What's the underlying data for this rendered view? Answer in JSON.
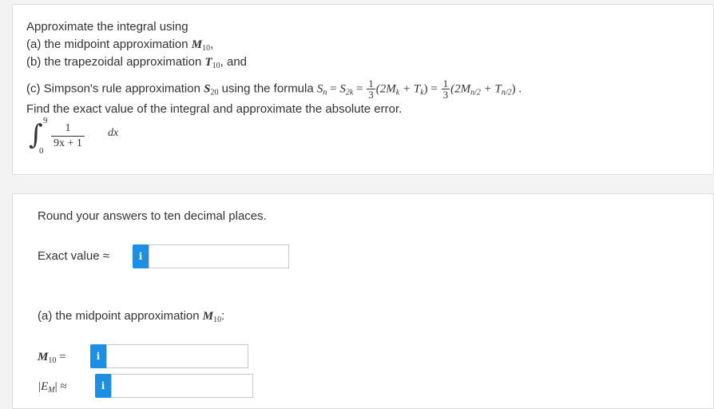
{
  "question": {
    "line1": "Approximate the integral using",
    "line2_text": "(a) the midpoint approximation ",
    "line2_math": "M",
    "line2_sub": "10",
    "line2_end": ",",
    "line3_text": "(b) the trapezoidal approximation ",
    "line3_math": "T",
    "line3_sub": "10",
    "line3_end": ",  and",
    "line4_text": "(c) Simpson's rule approximation ",
    "line4_S": "S",
    "line4_S_sub": "20",
    "line4_using": " using the formula ",
    "line4_Sn": "S",
    "line4_n": "n",
    "line4_eq1": " = ",
    "line4_S2k": "S",
    "line4_2k": "2k",
    "line4_eq2": " = ",
    "frac_num": "1",
    "frac_den": "3",
    "line4_part1": "(2M",
    "line4_k1": "k",
    "line4_part2": " + T",
    "line4_k2": "k",
    "line4_part3": ") = ",
    "line4_part4": "(2M",
    "line4_n2a": "n/2",
    "line4_part5": " + T",
    "line4_n2b": "n/2",
    "line4_part6": ") .",
    "line5": "Find the exact value of the integral and approximate the absolute error.",
    "integral": {
      "sign": "∫",
      "upper": "9",
      "lower": "0",
      "numerator": "1",
      "denominator": "9x + 1",
      "dx": "dx"
    }
  },
  "answer": {
    "instruction": "Round your answers to ten decimal places.",
    "exact_label": "Exact value  ≈",
    "exact_value": "",
    "part_a_title_text": "(a) the midpoint approximation ",
    "part_a_title_math": "M",
    "part_a_title_sub": "10",
    "part_a_title_end": ":",
    "m10_label_math": "M",
    "m10_label_sub": "10",
    "m10_label_eq": "  =",
    "m10_value": "",
    "em_label_open": "|E",
    "em_label_sub": "M",
    "em_label_close": "|  ≈",
    "em_value": "",
    "info_glyph": "i"
  },
  "colors": {
    "info_button": "#1a8fe3",
    "card_border": "#dcdcdc",
    "page_bg": "#f3f3f3"
  }
}
